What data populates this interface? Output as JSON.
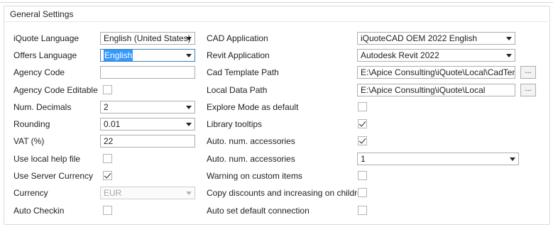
{
  "group_title": "General Settings",
  "left": {
    "iquote_language": {
      "label": "iQuote Language",
      "value": "English (United States)"
    },
    "offers_language": {
      "label": "Offers Language",
      "value": "English"
    },
    "agency_code": {
      "label": "Agency Code",
      "value": ""
    },
    "agency_code_editable": {
      "label": "Agency Code Editable",
      "checked": false
    },
    "num_decimals": {
      "label": "Num. Decimals",
      "value": "2"
    },
    "rounding": {
      "label": "Rounding",
      "value": "0.01"
    },
    "vat": {
      "label": "VAT (%)",
      "value": "22"
    },
    "use_local_help_file": {
      "label": "Use local help file",
      "checked": false
    },
    "use_server_currency": {
      "label": "Use Server Currency",
      "checked": true
    },
    "currency": {
      "label": "Currency",
      "value": "EUR"
    },
    "auto_checkin": {
      "label": "Auto Checkin",
      "checked": false
    }
  },
  "right": {
    "cad_application": {
      "label": "CAD Application",
      "value": "iQuoteCAD OEM 2022 English"
    },
    "revit_application": {
      "label": "Revit Application",
      "value": "Autodesk Revit 2022"
    },
    "cad_template_path": {
      "label": "Cad Template Path",
      "value": "E:\\Apice Consulting\\iQuote\\Local\\CadTempl",
      "button": "..."
    },
    "local_data_path": {
      "label": "Local Data Path",
      "value": "E:\\Apice Consulting\\iQuote\\Local",
      "button": "..."
    },
    "explore_mode_default": {
      "label": "Explore Mode as default",
      "checked": false
    },
    "library_tooltips": {
      "label": "Library tooltips",
      "checked": true
    },
    "auto_num_accessories_1": {
      "label": "Auto. num. accessories",
      "checked": true
    },
    "auto_num_accessories_2": {
      "label": "Auto. num. accessories",
      "value": "1"
    },
    "warning_custom_items": {
      "label": "Warning on custom items",
      "checked": false
    },
    "copy_discounts": {
      "label": "Copy discounts and increasing on children",
      "checked": false
    },
    "auto_set_default_connection": {
      "label": "Auto set default connection",
      "checked": false
    }
  }
}
